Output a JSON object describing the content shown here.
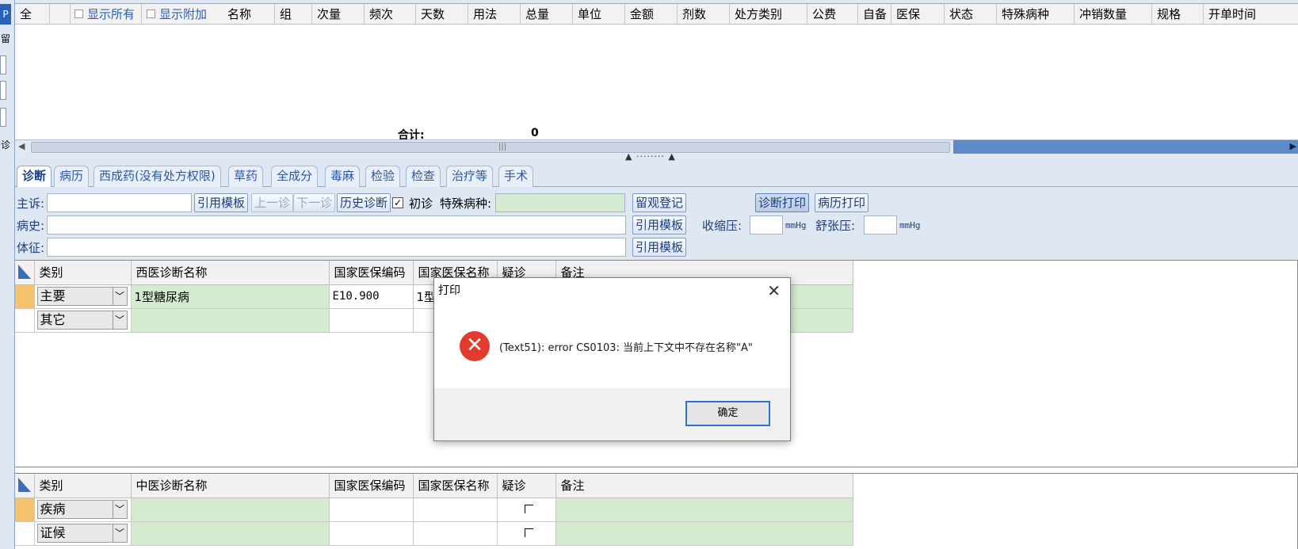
{
  "left_strip": {
    "top_label": "P",
    "label_2": "留",
    "label_3": "诊"
  },
  "top_grid": {
    "show_all": "显示所有",
    "show_extra": "显示附加",
    "columns": [
      "全",
      "名称",
      "组",
      "次量",
      "频次",
      "天数",
      "用法",
      "总量",
      "单位",
      "金额",
      "剂数",
      "处方类别",
      "公费",
      "自备",
      "医保",
      "状态",
      "特殊病种",
      "冲销数量",
      "规格",
      "开单时间"
    ],
    "total_label": "合计:",
    "total_value": "0"
  },
  "tabs": [
    "诊断",
    "病历",
    "西成药(没有处方权限)",
    "草药",
    "全成分",
    "毒麻",
    "检验",
    "检查",
    "治疗等",
    "手术"
  ],
  "active_tab": "诊断",
  "form": {
    "chief_complaint_label": "主诉:",
    "history_label": "病史:",
    "signs_label": "体征:",
    "template_btn": "引用模板",
    "prev_btn": "上一诊",
    "next_btn": "下一诊",
    "history_diag_btn": "历史诊断",
    "first_visit_label": "初诊",
    "first_visit_checked": true,
    "special_disease_label": "特殊病种:",
    "observation_btn": "留观登记",
    "diag_print_btn": "诊断打印",
    "record_print_btn": "病历打印",
    "systolic_label": "收缩压:",
    "diastolic_label": "舒张压:",
    "unit": "mmHg"
  },
  "western_table": {
    "headers": [
      "类别",
      "西医诊断名称",
      "国家医保编码",
      "国家医保名称",
      "疑诊",
      "备注"
    ],
    "rows": [
      {
        "category": "主要",
        "name": "1型糖尿病",
        "code": "E10.900",
        "ins_name": "1型"
      },
      {
        "category": "其它",
        "name": "",
        "code": "",
        "ins_name": ""
      }
    ]
  },
  "tcm_table": {
    "headers": [
      "类别",
      "中医诊断名称",
      "国家医保编码",
      "国家医保名称",
      "疑诊",
      "备注"
    ],
    "rows": [
      {
        "category": "疾病"
      },
      {
        "category": "证候"
      }
    ]
  },
  "dialog": {
    "title": "打印",
    "message": "(Text51): error CS0103: 当前上下文中不存在名称\"A\"",
    "ok_button": "确定"
  }
}
